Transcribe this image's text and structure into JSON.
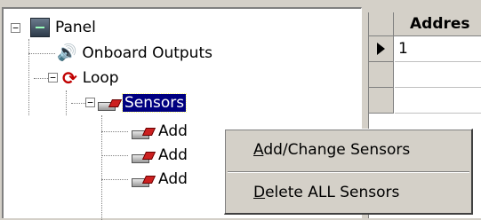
{
  "tree": {
    "expand_symbols": {
      "collapse": "−"
    },
    "nodes": [
      {
        "label": "Panel",
        "icon": "panel-icon"
      },
      {
        "label": "Onboard Outputs",
        "icon": "speaker-icon"
      },
      {
        "label": "Loop",
        "icon": "loop-icon"
      },
      {
        "label": "Sensors",
        "icon": "sensor-icon",
        "selected": true
      },
      {
        "label": "Add",
        "icon": "sensor-icon"
      },
      {
        "label": "Add",
        "icon": "sensor-icon"
      },
      {
        "label": "Add",
        "icon": "sensor-icon"
      }
    ]
  },
  "grid": {
    "column_header": "Addres",
    "rows": [
      {
        "value": "1",
        "current": true
      },
      {
        "value": ""
      },
      {
        "value": ""
      }
    ]
  },
  "context_menu": {
    "items": [
      {
        "accel": "A",
        "rest": "dd/Change Sensors"
      },
      {
        "accel": "D",
        "rest": "elete ALL Sensors"
      }
    ]
  }
}
